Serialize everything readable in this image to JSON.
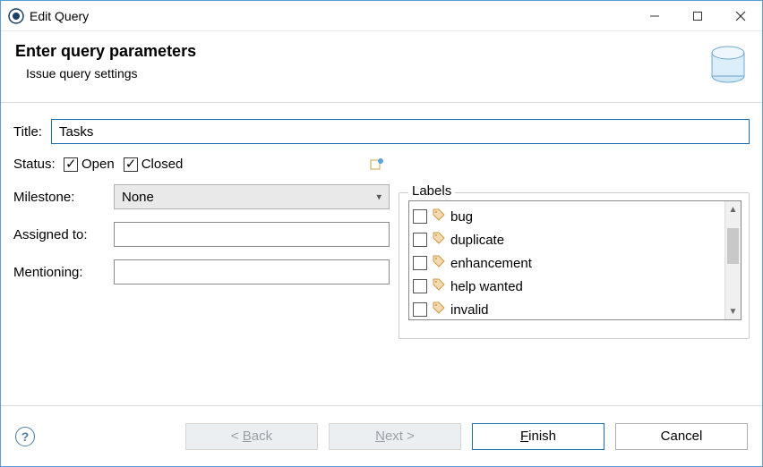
{
  "window": {
    "title": "Edit Query"
  },
  "header": {
    "title": "Enter query parameters",
    "subtitle": "Issue query settings"
  },
  "form": {
    "title_label": "Title:",
    "title_value": "Tasks",
    "status_label": "Status:",
    "status_open_label": "Open",
    "status_open_checked": true,
    "status_closed_label": "Closed",
    "status_closed_checked": true,
    "milestone_label": "Milestone:",
    "milestone_value": "None",
    "assigned_to_label": "Assigned to:",
    "assigned_to_value": "",
    "mentioning_label": "Mentioning:",
    "mentioning_value": ""
  },
  "labels": {
    "group_title": "Labels",
    "items": [
      {
        "text": "bug",
        "checked": false
      },
      {
        "text": "duplicate",
        "checked": false
      },
      {
        "text": "enhancement",
        "checked": false
      },
      {
        "text": "help wanted",
        "checked": false
      },
      {
        "text": "invalid",
        "checked": false
      }
    ]
  },
  "buttons": {
    "back": "< Back",
    "next": "Next >",
    "finish": "Finish",
    "cancel": "Cancel"
  }
}
